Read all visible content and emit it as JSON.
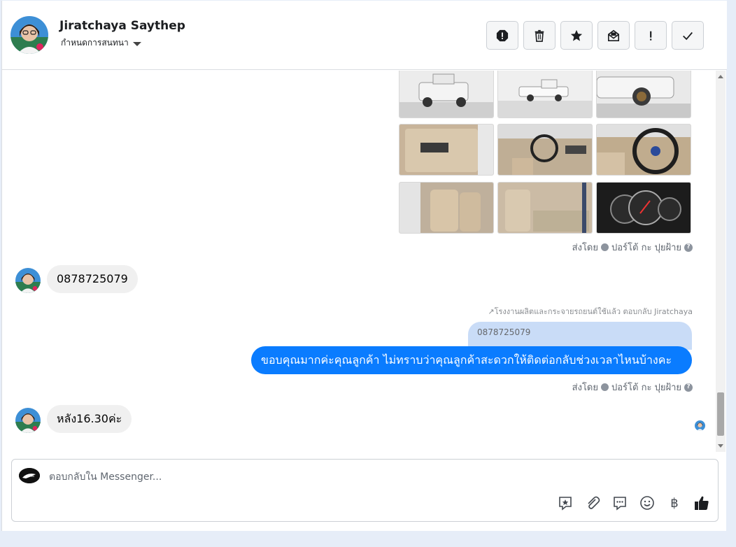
{
  "header": {
    "name": "Jiratchaya Saythep",
    "subtitle": "กำหนดการสนทนา",
    "actions": [
      "spam-icon",
      "trash-icon",
      "star-icon",
      "mark-unread-icon",
      "important-icon",
      "done-icon"
    ]
  },
  "thread": {
    "sent_by_1": "ส่งโดย",
    "sender_1": "ปอร์โต้ กะ ปุยฝ้าย",
    "incoming_1": "0878725079",
    "reply_context": "โรงงานผลิตและกระจายรถยนต์ใช้แล้ว ตอบกลับ Jiratchaya",
    "quoted_text": "0878725079",
    "outgoing_1": "ขอบคุณมากค่ะคุณลูกค้า ไม่ทราบว่าคุณลูกค้าสะดวกให้ติดต่อกลับช่วงเวลาไหนบ้างคะ",
    "sent_by_2": "ส่งโดย",
    "sender_2": "ปอร์โต้ กะ ปุยฝ้าย",
    "incoming_2": "หลัง16.30ค่ะ"
  },
  "composer": {
    "placeholder": "ตอบกลับใน Messenger...",
    "tools": [
      "saved-reply-icon",
      "attach-icon",
      "quick-reply-icon",
      "emoji-icon",
      "baht-icon",
      "like-icon"
    ],
    "baht_symbol": "฿"
  },
  "colors": {
    "outgoing": "#0a7cff",
    "incoming": "#f0f0f0",
    "quoted": "#c9dcf7"
  }
}
